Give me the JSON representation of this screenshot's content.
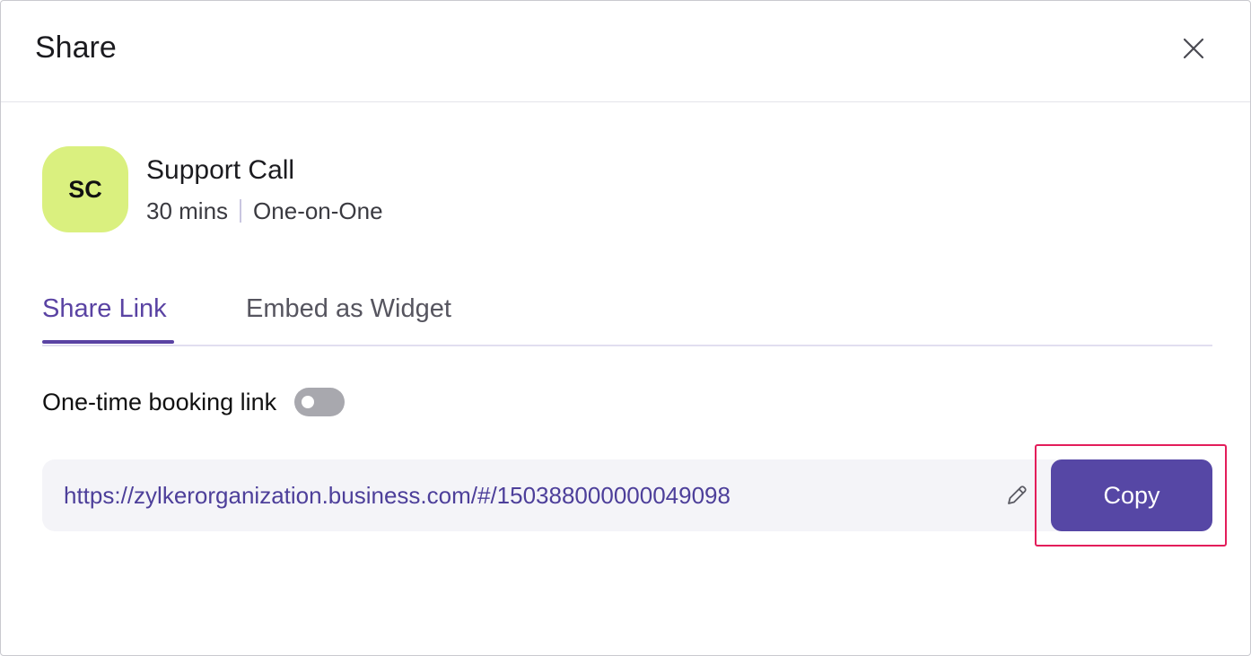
{
  "dialog": {
    "title": "Share",
    "close_icon": "close-icon"
  },
  "event": {
    "initials": "SC",
    "avatar_color": "#daf07f",
    "name": "Support Call",
    "duration": "30 mins",
    "type": "One-on-One"
  },
  "tabs": [
    {
      "label": "Share Link",
      "active": true
    },
    {
      "label": "Embed as Widget",
      "active": false
    }
  ],
  "onetime_link": {
    "label": "One-time booking link",
    "enabled": false
  },
  "link": {
    "url": "https://zylkerorganization.business.com/#/150388000000049098",
    "edit_icon": "pencil-icon"
  },
  "copy_button": {
    "label": "Copy"
  },
  "colors": {
    "accent": "#5647a5",
    "active_tab": "#5a43a3",
    "highlight": "#e31d5a"
  }
}
